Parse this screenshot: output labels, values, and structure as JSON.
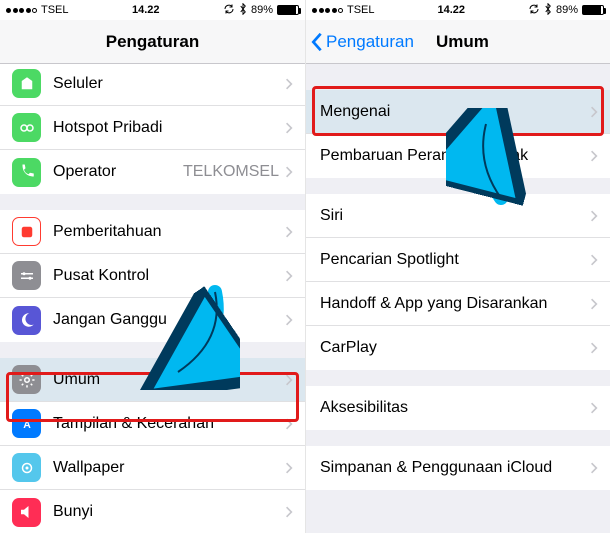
{
  "status": {
    "carrier": "TSEL",
    "time": "14.22",
    "battery_pct": "89%",
    "battery_fill": 89
  },
  "left": {
    "nav_title": "Pengaturan",
    "rows": {
      "cellular": {
        "label": "Seluler",
        "color": "#4cd964"
      },
      "hotspot": {
        "label": "Hotspot Pribadi",
        "color": "#4cd964"
      },
      "carrier": {
        "label": "Operator",
        "value": "TELKOMSEL",
        "color": "#4cd964"
      },
      "notif": {
        "label": "Pemberitahuan",
        "color": "#ff3b30"
      },
      "control": {
        "label": "Pusat Kontrol",
        "color": "#8e8e93"
      },
      "dnd": {
        "label": "Jangan Ganggu",
        "color": "#5856d6"
      },
      "general": {
        "label": "Umum",
        "color": "#8e8e93"
      },
      "display": {
        "label": "Tampilan & Kecerahan",
        "color": "#007aff"
      },
      "wallpaper": {
        "label": "Wallpaper",
        "color": "#54c7ec"
      },
      "sound": {
        "label": "Bunyi",
        "color": "#ff2d55"
      }
    }
  },
  "right": {
    "nav_back": "Pengaturan",
    "nav_title": "Umum",
    "rows": {
      "about": {
        "label": "Mengenai"
      },
      "swupdate": {
        "label": "Pembaruan Perangkat Lunak"
      },
      "siri": {
        "label": "Siri"
      },
      "spotlight": {
        "label": "Pencarian Spotlight"
      },
      "handoff": {
        "label": "Handoff & App yang Disarankan"
      },
      "carplay": {
        "label": "CarPlay"
      },
      "access": {
        "label": "Aksesibilitas"
      },
      "storage": {
        "label": "Simpanan & Penggunaan iCloud"
      }
    }
  }
}
